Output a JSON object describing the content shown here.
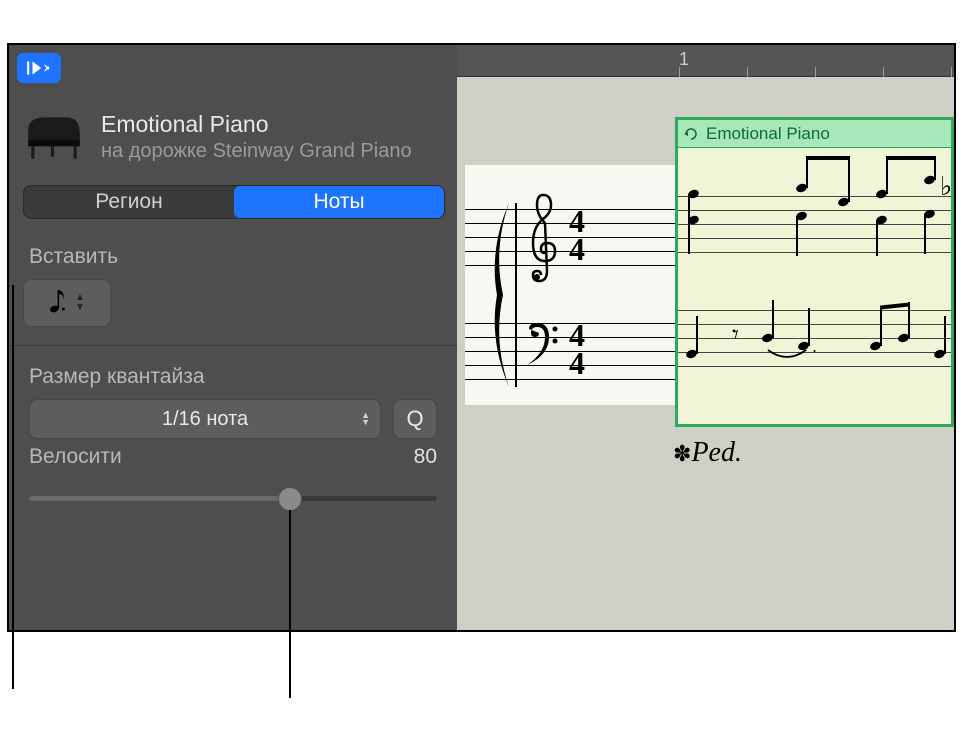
{
  "header": {
    "title": "Emotional Piano",
    "subtitle": "на дорожке Steinway Grand Piano"
  },
  "segments": {
    "region": "Регион",
    "notes": "Ноты"
  },
  "insert": {
    "label": "Вставить"
  },
  "quantize": {
    "label": "Размер квантайза",
    "value": "1/16 нота",
    "button": "Q"
  },
  "velocity": {
    "label": "Велосити",
    "value": "80"
  },
  "ruler": {
    "bar1": "1"
  },
  "region": {
    "name": "Emotional Piano"
  },
  "time_signature": {
    "top": "4",
    "bottom": "4"
  },
  "pedal": {
    "text": "Ped."
  }
}
